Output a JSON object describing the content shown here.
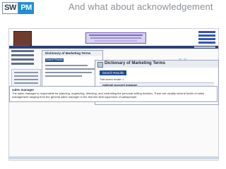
{
  "logo": {
    "left_text": "SW",
    "right_text": "PM"
  },
  "slide": {
    "title": "And what about acknowledgement"
  },
  "dictionary_panel_back": {
    "title": "Dictionary of Marketing Terms",
    "search_button": "Search Results"
  },
  "dictionary_panel_front": {
    "title": "Dictionary of Marketing Terms",
    "search_button": "Search Results",
    "result_row": "Total search results: 1",
    "result_term": "national account manager"
  },
  "popup": {
    "term": "sales manager",
    "definition": "The sales manager is responsible for planning, organizing, directing, and controlling the personal selling function. There are usually several levels of sales management ranging from the general sales manager to the first line field supervisor of salespeople."
  },
  "colors": {
    "accent": "#1e8fd8",
    "navbar": "#2e3f78",
    "button": "#21498f"
  },
  "icons": {
    "site_logo": "site-logo-icon",
    "dictionary": "dictionary-icon"
  }
}
